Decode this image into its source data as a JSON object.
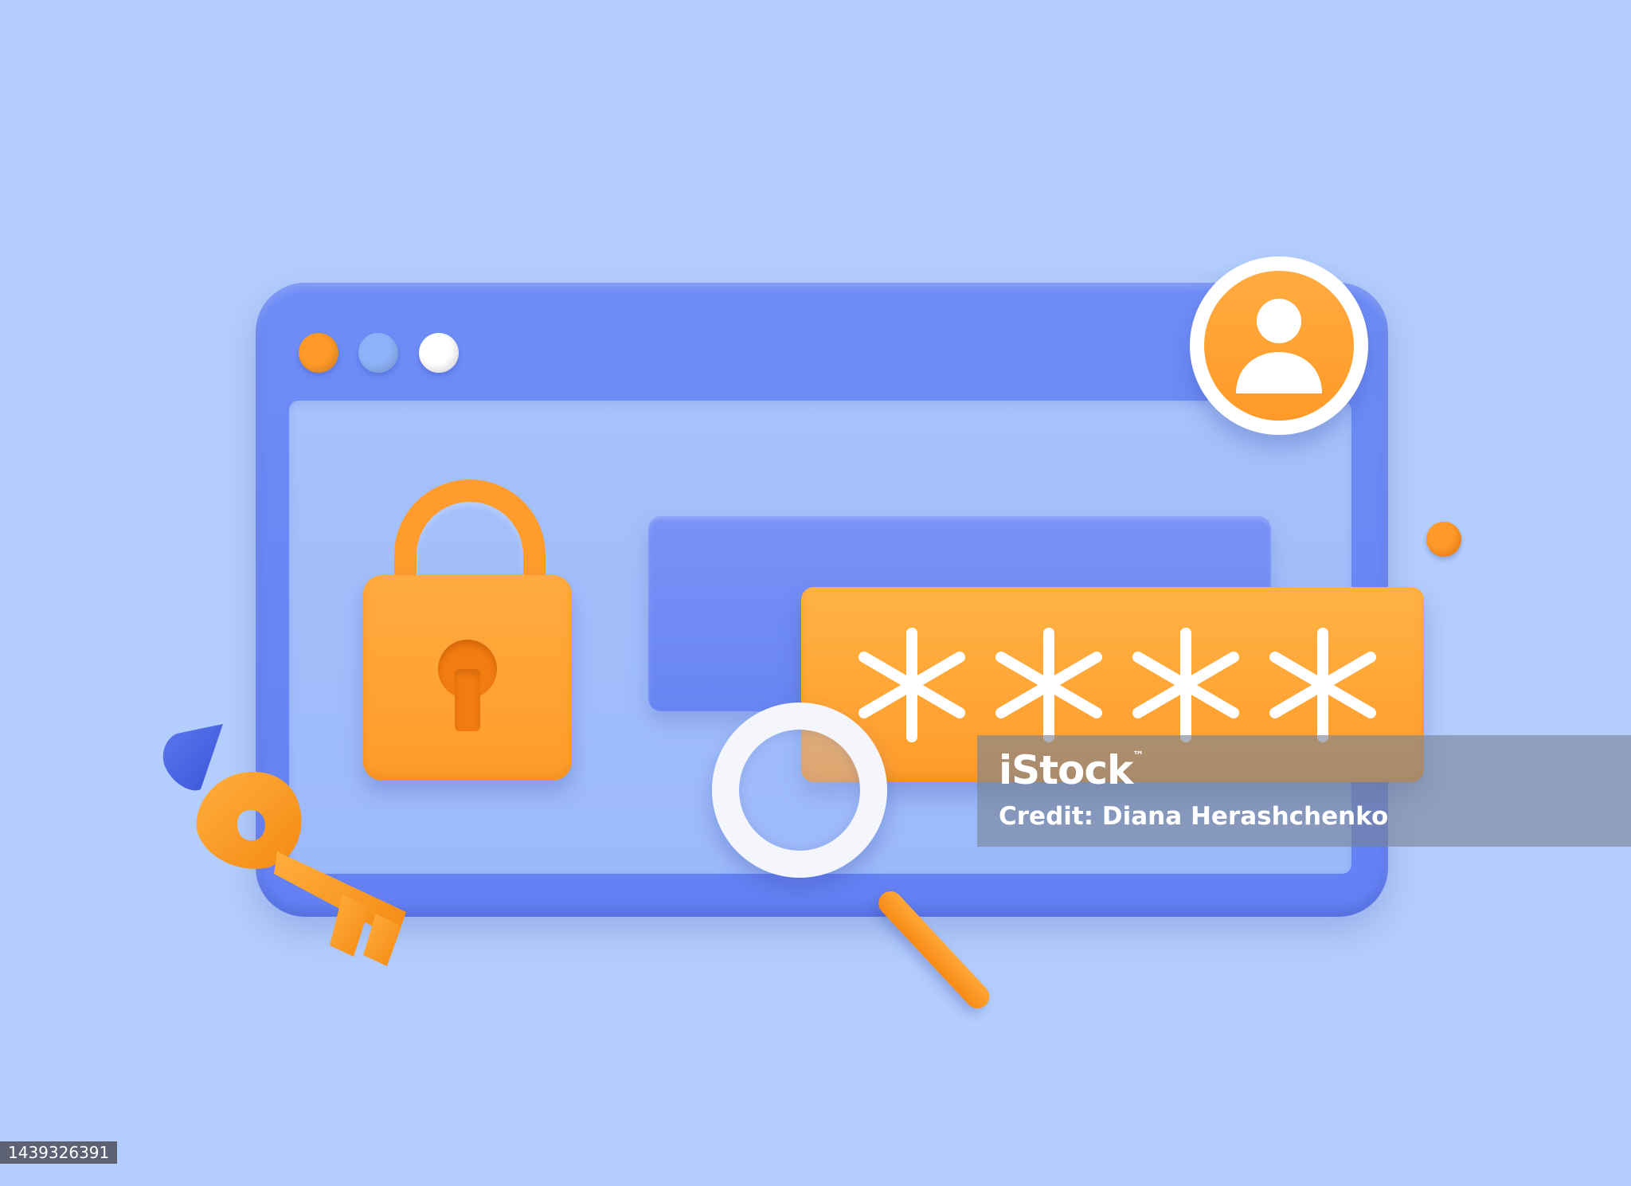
{
  "illustration": {
    "colors": {
      "background": "#b3cdfc",
      "window_frame": "#6f8df6",
      "window_content": "#a6c2fb",
      "accent_orange": "#ff9c2a",
      "accent_white": "#ffffff"
    },
    "window": {
      "control_dots": [
        "orange",
        "blue",
        "white"
      ]
    },
    "icons": {
      "user": "user-icon",
      "lock": "padlock-icon",
      "key": "key-icon",
      "magnifier": "magnifying-glass-icon",
      "password_mask": "asterisk-icon"
    },
    "password_field": {
      "masked_characters": 4
    }
  },
  "watermark": {
    "brand": "iStock",
    "trademark": "™",
    "credit": "Credit: Diana Herashchenko"
  },
  "image_id": "1439326391"
}
